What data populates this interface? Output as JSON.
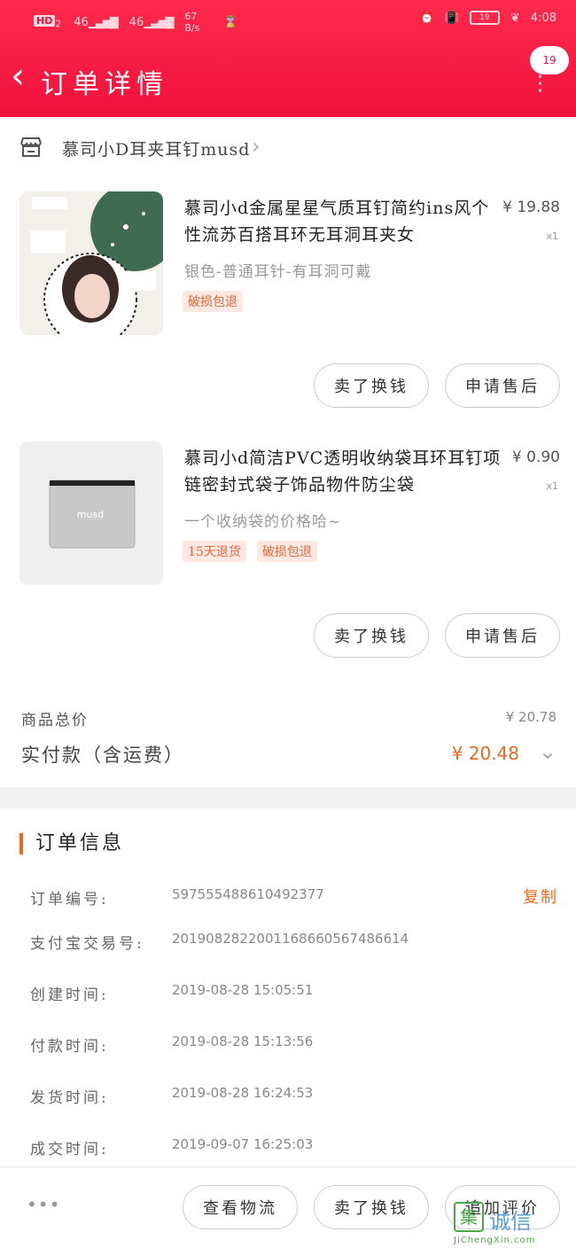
{
  "status_bar": {
    "hd": "HD",
    "sim": "2",
    "net1": "46",
    "net2": "46",
    "speed": "67 B/s",
    "battery": "19",
    "time": "4:08"
  },
  "header": {
    "title": "订单详情",
    "bubble_count": "19"
  },
  "shop": {
    "name": "慕司小D耳夹耳钉musd"
  },
  "products": [
    {
      "title": "慕司小d金属星星气质耳钉简约ins风个性流苏百搭耳环无耳洞耳夹女",
      "price": "¥ 19.88",
      "qty": "x1",
      "spec": "银色-普通耳针-有耳洞可戴",
      "tags": [
        "破损包退"
      ],
      "button_sell": "卖了换钱",
      "button_aftersale": "申请售后"
    },
    {
      "title": "慕司小d简洁PVC透明收纳袋耳环耳钉项链密封式袋子饰品物件防尘袋",
      "price": "¥ 0.90",
      "qty": "x1",
      "spec": "一个收纳袋的价格哈~",
      "tags": [
        "15天退货",
        "破损包退"
      ],
      "thumb_text": "musd",
      "button_sell": "卖了换钱",
      "button_aftersale": "申请售后"
    }
  ],
  "totals": {
    "goods_label": "商品总价",
    "goods_value": "¥ 20.78",
    "paid_label": "实付款（含运费）",
    "paid_value": "¥ 20.48"
  },
  "order_info": {
    "title": "订单信息",
    "copy_label": "复制",
    "rows": [
      {
        "label": "订单编号:",
        "value": "597555488610492377"
      },
      {
        "label": "支付宝交易号:",
        "value": "2019082822001168660567486614"
      },
      {
        "label": "创建时间:",
        "value": "2019-08-28 15:05:51"
      },
      {
        "label": "付款时间:",
        "value": "2019-08-28 15:13:56"
      },
      {
        "label": "发货时间:",
        "value": "2019-08-28 16:24:53"
      },
      {
        "label": "成交时间:",
        "value": "2019-09-07 16:25:03"
      }
    ]
  },
  "bottom_bar": {
    "more": "•••",
    "logistics": "查看物流",
    "sell": "卖了换钱",
    "review": "追加评价"
  },
  "watermark": {
    "box": "集",
    "text": "诚信",
    "url": "JiChengXin.com"
  },
  "colors": {
    "header_red": "#f0113a",
    "accent_orange": "#ea6a1f",
    "tag_bg": "#fde8e2"
  }
}
